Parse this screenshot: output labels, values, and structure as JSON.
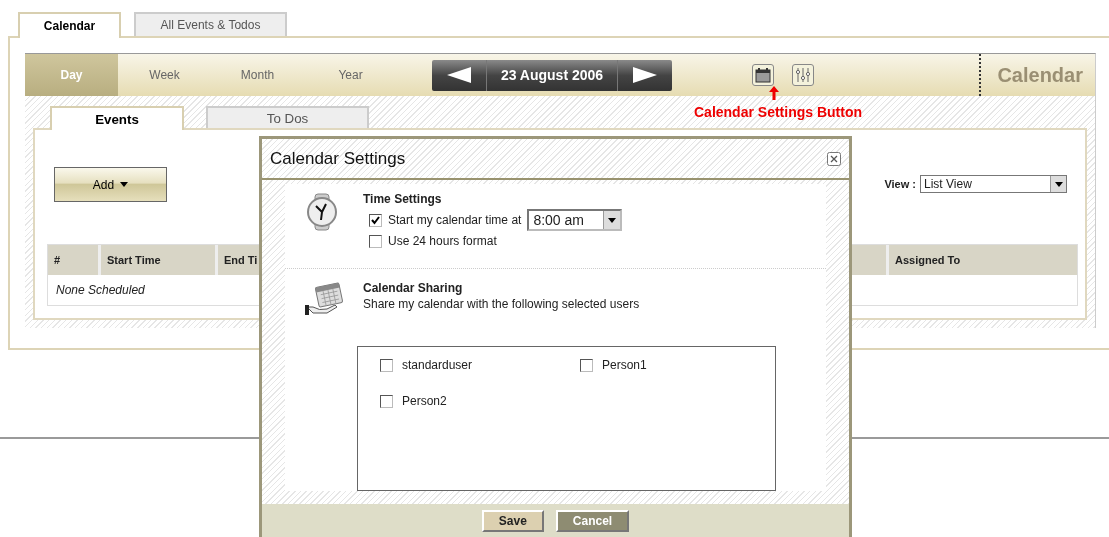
{
  "top_tabs": [
    {
      "label": "Calendar",
      "selected": true
    },
    {
      "label": "All Events & Todos",
      "selected": false
    }
  ],
  "view_tabs": [
    {
      "label": "Day",
      "selected": true
    },
    {
      "label": "Week",
      "selected": false
    },
    {
      "label": "Month",
      "selected": false
    },
    {
      "label": "Year",
      "selected": false
    }
  ],
  "date": "23 August 2006",
  "toolbar_title": "Calendar",
  "annotation": "Calendar Settings Button",
  "sub_tabs": [
    {
      "label": "Events",
      "selected": true
    },
    {
      "label": "To Dos",
      "selected": false
    }
  ],
  "add_button": "Add",
  "view_select": {
    "label": "View :",
    "value": "List View"
  },
  "table": {
    "columns": [
      "#",
      "Start Time",
      "End Ti",
      "Assigned To"
    ],
    "empty_text": "None Scheduled"
  },
  "dialog": {
    "title": "Calendar Settings",
    "time_heading": "Time Settings",
    "time_options": [
      {
        "kind": "select",
        "label": "Start my calendar time at",
        "checked": true,
        "value": "8:00 am"
      },
      {
        "kind": "plain",
        "label": "Use 24 hours format",
        "checked": false
      }
    ],
    "sharing_heading": "Calendar Sharing",
    "sharing_text": "Share my calendar with the following selected users",
    "users": [
      {
        "name": "standarduser",
        "checked": false
      },
      {
        "name": "Person1",
        "checked": false
      },
      {
        "name": "Person2",
        "checked": false
      }
    ],
    "buttons": [
      {
        "label": "Save",
        "kind": "primary"
      },
      {
        "label": "Cancel",
        "kind": "secondary"
      }
    ]
  }
}
